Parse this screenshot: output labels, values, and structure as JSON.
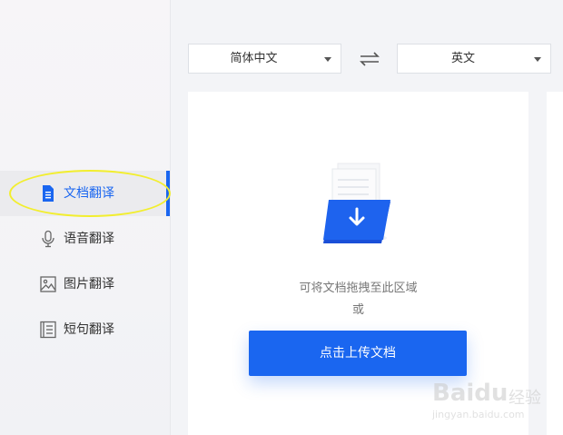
{
  "sidebar": {
    "items": [
      {
        "label": "文档翻译",
        "icon": "document-icon",
        "active": true
      },
      {
        "label": "语音翻译",
        "icon": "microphone-icon",
        "active": false
      },
      {
        "label": "图片翻译",
        "icon": "image-icon",
        "active": false
      },
      {
        "label": "短句翻译",
        "icon": "sentence-icon",
        "active": false
      }
    ]
  },
  "translator": {
    "source_lang": "简体中文",
    "target_lang": "英文",
    "swap_icon": "swap-arrows-icon"
  },
  "upload": {
    "hint": "可将文档拖拽至此区域",
    "or": "或",
    "button_label": "点击上传文档",
    "illustration_icon": "document-download-icon"
  },
  "watermark": {
    "brand": "Baidu",
    "brand_cn": "经验",
    "url": "jingyan.baidu.com"
  },
  "colors": {
    "accent": "#1a66f0",
    "highlight": "#f2ee2e"
  }
}
